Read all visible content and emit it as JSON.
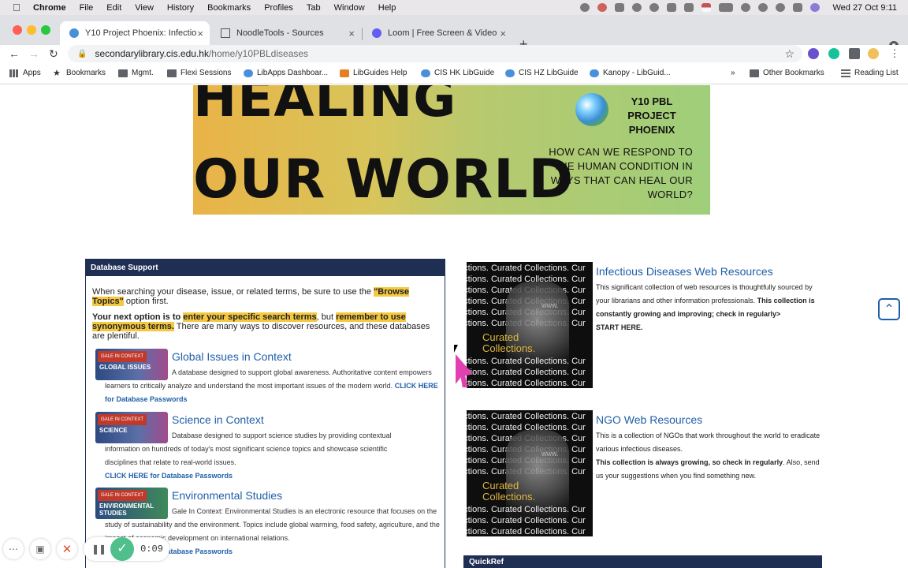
{
  "menubar": {
    "app": "Chrome",
    "items": [
      "File",
      "Edit",
      "View",
      "History",
      "Bookmarks",
      "Profiles",
      "Tab",
      "Window",
      "Help"
    ],
    "clock": "Wed 27 Oct  9:11"
  },
  "tabs": [
    {
      "title": "Y10 Project Phoenix: Infectious",
      "active": true
    },
    {
      "title": "NoodleTools - Sources",
      "active": false
    },
    {
      "title": "Loom | Free Screen & Video Re",
      "active": false
    }
  ],
  "address": {
    "host": "secondarylibrary.cis.edu.hk",
    "path": "/home/y10PBLdiseases"
  },
  "bookmarks": {
    "items": [
      "Apps",
      "Bookmarks",
      "Mgmt.",
      "Flexi Sessions",
      "LibApps Dashboar...",
      "LibGuides Help",
      "CIS HK LibGuide",
      "CIS HZ LibGuide",
      "Kanopy - LibGuid..."
    ],
    "overflow": "»",
    "other": "Other Bookmarks",
    "reading": "Reading List"
  },
  "banner": {
    "line1": "HEALING",
    "line2": "OUR WORLD",
    "pbl_line1": "Y10 PBL",
    "pbl_line2": "PROJECT PHOENIX",
    "question": "HOW CAN WE RESPOND TO THE HUMAN CONDITION IN WAYS THAT CAN HEAL OUR WORLD?"
  },
  "database_support": {
    "heading": "Database Support",
    "p1_a": "When searching your disease, issue, or related terms, be sure to use the ",
    "p1_hl": "\"Browse Topics\"",
    "p1_b": " option first.",
    "p2_a": "Your next option is to ",
    "p2_hl1": "enter your specific search terms",
    "p2_b": ", but ",
    "p2_hl2": "remember to use synonymous terms.",
    "p2_c": " There are many ways to discover resources, and these databases are plentiful.",
    "databases": [
      {
        "badge": "GALE IN CONTEXT",
        "thumb_label": "GLOBAL ISSUES",
        "title": "Global Issues in Context",
        "desc": "A database designed to support global awareness. Authoritative content empowers learners to critically analyze and understand the most important issues of the modern world.",
        "link": "CLICK HERE for Database Passwords"
      },
      {
        "badge": "GALE IN CONTEXT",
        "thumb_label": "SCIENCE",
        "title": "Science in Context",
        "desc": "Database designed to support science studies by providing contextual information on hundreds of today's most significant science topics and showcase scientific disciplines that relate to real-world issues.",
        "link": "CLICK HERE for Database Passwords"
      },
      {
        "badge": "GALE IN CONTEXT",
        "thumb_label": "ENVIRONMENTAL STUDIES",
        "title": "Environmental Studies",
        "desc": "Gale In Context: Environmental Studies is an electronic resource that focuses on the study of sustainability and the environment. Topics include global warming, food safety, agriculture, and the impact of economic development on international relations.",
        "link": "CLICK HERE for Database Passwords"
      }
    ]
  },
  "collections": {
    "row_text": "ections. Curated Collections. Cur",
    "highlight_1": "Curated",
    "highlight_2": "Collections.",
    "url_glyph": "www."
  },
  "resources": [
    {
      "title": "Infectious Diseases Web Resources",
      "desc": "This significant collection of web resources is thoughtfully sourced by your librarians and other information professionals.",
      "desc_bold": "This collection is constantly growing and improving; check in regularly>",
      "cta": "START HERE."
    },
    {
      "title": "NGO Web Resources",
      "desc": "This is a collection of NGOs that work throughout the world to eradicate various infectious diseases.",
      "desc_bold": "This collection is always growing, so check in regularly",
      "desc_tail": ". Also, send us your suggestions when you find something new."
    }
  ],
  "quickref": {
    "heading": "QuickRef"
  },
  "loom": {
    "timer": "0:09"
  },
  "colors": {
    "navy": "#1f2f54",
    "link": "#1f5fa8",
    "highlight": "#f5c842",
    "loom_green": "#4fbf8c"
  }
}
